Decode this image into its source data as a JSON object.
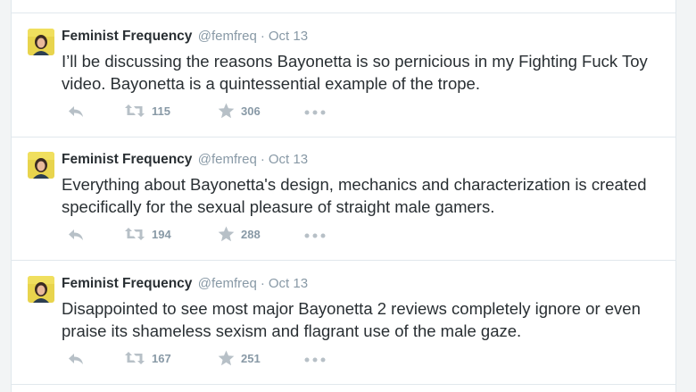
{
  "colors": {
    "name": "#292f33",
    "meta": "#8899a6",
    "icon": "#b7c0c7",
    "border": "#e1e8ed"
  },
  "tweets": [
    {
      "name": "Feminist Frequency",
      "handle": "@femfreq",
      "separator": "·",
      "time": "Oct 13",
      "text": "I’ll be discussing the reasons Bayonetta is so pernicious in my Fighting Fuck Toy video. Bayonetta is a quintessential example of the trope.",
      "retweets": "115",
      "favorites": "306"
    },
    {
      "name": "Feminist Frequency",
      "handle": "@femfreq",
      "separator": "·",
      "time": "Oct 13",
      "text": "Everything about Bayonetta's design, mechanics and characterization is created specifically for the sexual pleasure of straight male gamers.",
      "retweets": "194",
      "favorites": "288"
    },
    {
      "name": "Feminist Frequency",
      "handle": "@femfreq",
      "separator": "·",
      "time": "Oct 13",
      "text": "Disappointed to see most major Bayonetta 2 reviews completely ignore or even praise its shameless sexism and flagrant use of the male gaze.",
      "retweets": "167",
      "favorites": "251"
    }
  ],
  "icons": {
    "reply": "reply-icon",
    "retweet": "retweet-icon",
    "favorite": "star-icon",
    "more": "more-icon",
    "avatar": "avatar"
  }
}
